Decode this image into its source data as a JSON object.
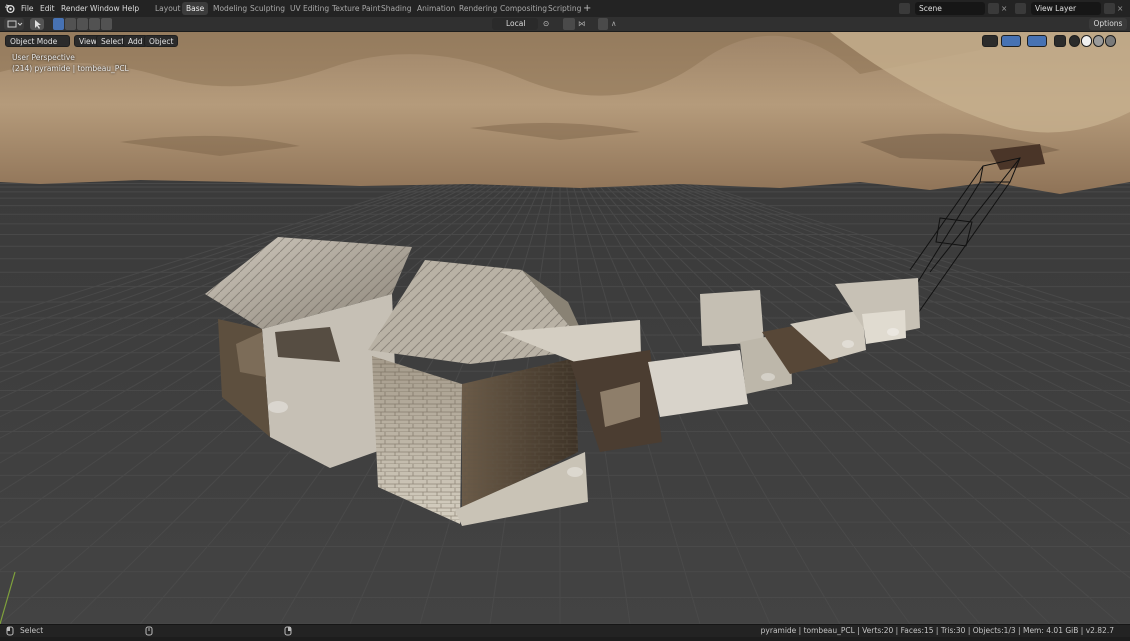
{
  "app": {
    "logo_icon": "blender-logo-icon"
  },
  "menu": [
    "File",
    "Edit",
    "Render",
    "Window",
    "Help"
  ],
  "workspaces": {
    "tabs": [
      "Layout",
      "Base",
      "Modeling",
      "Sculpting",
      "UV Editing",
      "Texture Paint",
      "Shading",
      "Animation",
      "Rendering",
      "Compositing",
      "Scripting"
    ],
    "active": "Base",
    "add_icon": "plus-icon"
  },
  "scene": {
    "label": "Scene"
  },
  "view_layer": {
    "label": "View Layer"
  },
  "header": {
    "mode": "Object Mode",
    "menus": [
      "View",
      "Select",
      "Add",
      "Object"
    ],
    "transform_orientation": "Local",
    "options_label": "Options"
  },
  "viewport": {
    "view_name": "User Perspective",
    "object_info": "(214) pyramide | tombeau_PCL"
  },
  "statusbar": {
    "left_label": "Select",
    "stats": "pyramide | tombeau_PCL | Verts:20 | Faces:15 | Tris:30 | Objects:1/3 | Mem: 4.01 GiB | v2.82.7"
  },
  "colors": {
    "accent": "#4772b3",
    "grid_background": "#3d3d3d",
    "topbar": "#232323",
    "header": "#303030",
    "sand": "#a88d6d"
  }
}
